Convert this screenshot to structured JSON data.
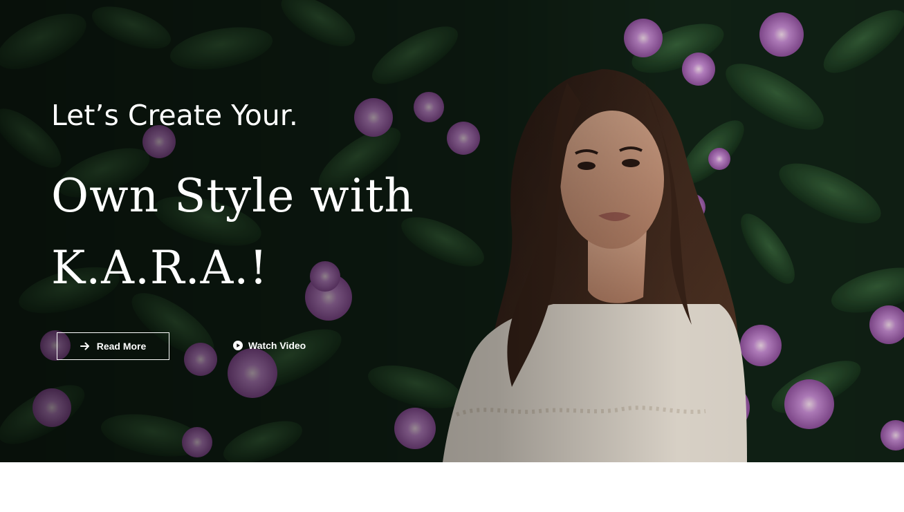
{
  "hero": {
    "subtitle": "Let’s Create Your.",
    "headline_line1": "Own Style with",
    "headline_line2": "K.A.R.A.!",
    "read_more_label": "Read More",
    "watch_video_label": "Watch Video",
    "read_more_icon": "arrow-right-icon",
    "watch_video_icon": "play-circle-icon"
  },
  "colors": {
    "text": "#ffffff",
    "overlay": "#000000",
    "foliage": "#1f3a24",
    "flower": "#b77ac0"
  }
}
